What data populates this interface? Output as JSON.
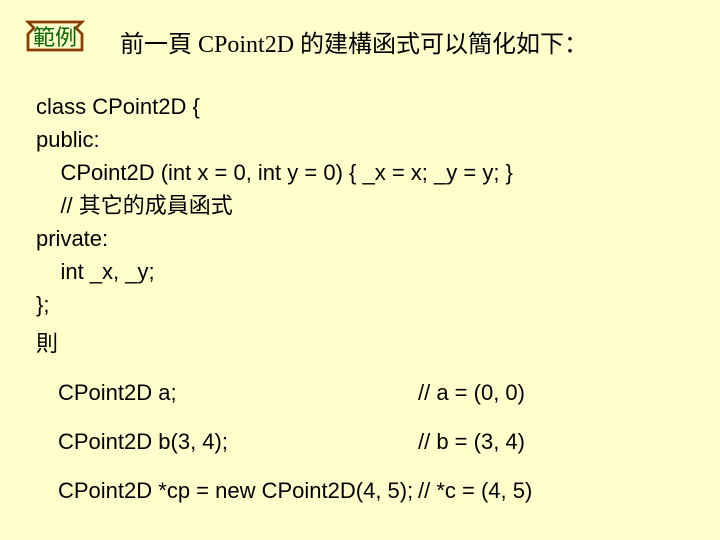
{
  "badge": {
    "label": "範例"
  },
  "headline": "前一頁 CPoint2D 的建構函式可以簡化如下：",
  "code": {
    "l1": "class CPoint2D {",
    "l2": "public:",
    "l3": "    CPoint2D (int x = 0, int y = 0) { _x = x; _y = y; }",
    "l4": "    // 其它的成員函式",
    "l5": "private:",
    "l6": "    int _x, _y;",
    "l7": "};"
  },
  "then": "則",
  "examples": [
    {
      "decl": "CPoint2D a;",
      "comment": "// a = (0, 0)"
    },
    {
      "decl": "CPoint2D b(3, 4);",
      "comment": "// b = (3, 4)"
    },
    {
      "decl": "CPoint2D *cp = new CPoint2D(4, 5);",
      "comment": "// *c = (4, 5)"
    }
  ]
}
